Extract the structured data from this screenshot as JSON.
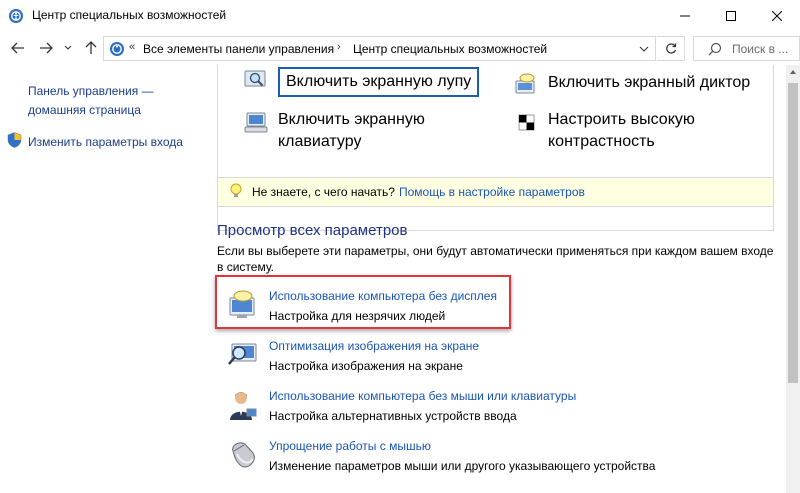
{
  "window": {
    "title": "Центр специальных возможностей",
    "icon": "ease-of-access-icon"
  },
  "nav": {
    "breadcrumb": [
      "Все элементы панели управления",
      "Центр специальных возможностей"
    ],
    "search_placeholder": "Поиск в ..."
  },
  "left": {
    "home_link": "Панель управления — домашняя страница",
    "signin_link": "Изменить параметры входа"
  },
  "quick": {
    "magnifier": "Включить экранную лупу",
    "narrator": "Включить экранный диктор",
    "keyboard_line1": "Включить экранную",
    "keyboard_line2": "клавиатуру",
    "contrast_line1": "Настроить высокую",
    "contrast_line2": "контрастность"
  },
  "tip": {
    "text": "Не знаете, с чего начать?",
    "link": "Помощь в настройке параметров"
  },
  "section": {
    "title": "Просмотр всех параметров",
    "desc": "Если вы выберете эти параметры, они будут автоматически применяться при каждом вашем входе в систему."
  },
  "options": [
    {
      "title": "Использование компьютера без дисплея",
      "desc": "Настройка для незрячих людей"
    },
    {
      "title": "Оптимизация изображения на экране",
      "desc": "Настройка изображения на экране"
    },
    {
      "title": "Использование компьютера без мыши или клавиатуры",
      "desc": "Настройка альтернативных устройств ввода"
    },
    {
      "title": "Упрощение работы с мышью",
      "desc": "Изменение параметров мыши или другого указывающего устройства"
    }
  ],
  "colors": {
    "link": "#1a55b5",
    "heading": "#1e3287",
    "highlight": "#e0353b",
    "tip_bg": "#ffffe1"
  }
}
